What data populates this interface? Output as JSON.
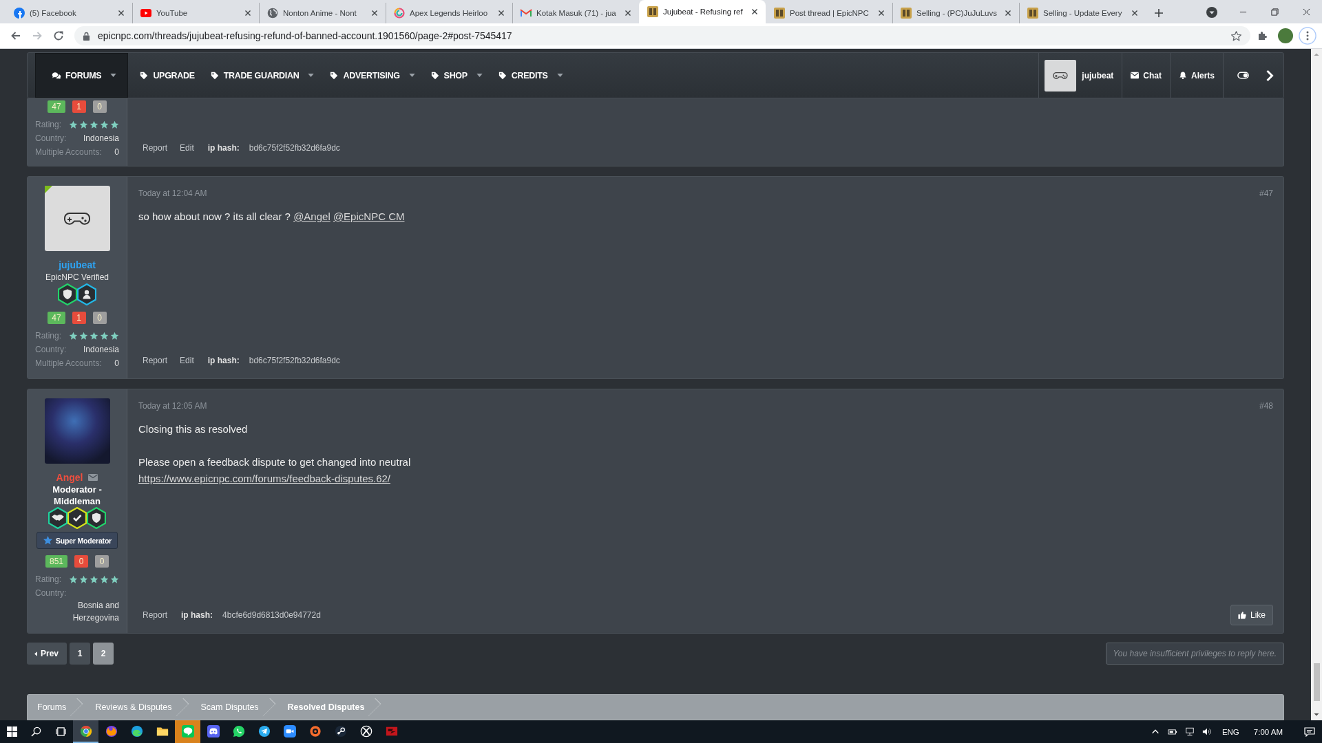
{
  "browser": {
    "tabs": [
      {
        "title": "(5) Facebook",
        "kind": "round",
        "selected": false
      },
      {
        "title": "YouTube",
        "kind": "video",
        "selected": false
      },
      {
        "title": "Nonton Anime - Nont",
        "kind": "globe",
        "selected": false
      },
      {
        "title": "Apex Legends Heirloo",
        "kind": "swirl",
        "selected": false
      },
      {
        "title": "Kotak Masuk (71) - jua",
        "kind": "mail",
        "selected": false
      },
      {
        "title": "Jujubeat - Refusing ref",
        "kind": "site",
        "selected": true
      },
      {
        "title": "Post thread | EpicNPC",
        "kind": "site",
        "selected": false
      },
      {
        "title": "Selling - (PC)JuJuLuvs",
        "kind": "site",
        "selected": false
      },
      {
        "title": "Selling - Update Every",
        "kind": "site",
        "selected": false
      }
    ],
    "toolbar": [
      {
        "kind": "back",
        "disabled": false
      },
      {
        "kind": "forward",
        "disabled": true
      },
      {
        "kind": "reload",
        "disabled": false
      }
    ],
    "address": "epicnpc.com/threads/jujubeat-refusing-refund-of-banned-account.1901560/page-2#post-7545417"
  },
  "nav": {
    "items": [
      {
        "label": "FORUMS",
        "kind": "comments",
        "dropdown": true,
        "selected": true
      },
      {
        "label": "UPGRADE",
        "kind": "tag",
        "dropdown": false,
        "selected": false
      },
      {
        "label": "TRADE GUARDIAN",
        "kind": "tag",
        "dropdown": true,
        "selected": false
      },
      {
        "label": "ADVERTISING",
        "kind": "tag",
        "dropdown": true,
        "selected": false
      },
      {
        "label": "SHOP",
        "kind": "tag",
        "dropdown": true,
        "selected": false
      },
      {
        "label": "CREDITS",
        "kind": "tag",
        "dropdown": true,
        "selected": false
      }
    ],
    "account": {
      "name": "jujubeat"
    },
    "links": [
      {
        "label": "Chat",
        "kind": "envelope"
      },
      {
        "label": "Alerts",
        "kind": "bell"
      }
    ]
  },
  "posts": [
    {
      "stats": [
        {
          "value": "47",
          "color": "#5cb85c"
        },
        {
          "value": "1",
          "color": "#e74c3c"
        },
        {
          "value": "0",
          "color": "#9e9e9e"
        }
      ],
      "rating_label": "Rating:",
      "stars": 5,
      "fields": [
        {
          "label": "Country:",
          "value": "Indonesia"
        },
        {
          "label": "Multiple Accounts:",
          "value": "0"
        }
      ],
      "actions": [
        "Report",
        "Edit"
      ],
      "ip_label": "ip hash:",
      "ip_hash": "bd6c75f2f52fb32d6fa9dc"
    },
    {
      "author": {
        "name": "jujubeat",
        "color": "#2ea3f2",
        "title": "EpicNPC Verified",
        "staff": false,
        "mail": false,
        "online": true,
        "avatar": {
          "kind": "gamepad"
        }
      },
      "badges": [
        {
          "kind": "shield",
          "color": "#22d36b"
        },
        {
          "kind": "person",
          "color": "#22b8e8"
        }
      ],
      "stats": [
        {
          "value": "47",
          "color": "#5cb85c"
        },
        {
          "value": "1",
          "color": "#e74c3c"
        },
        {
          "value": "0",
          "color": "#9e9e9e"
        }
      ],
      "rating_label": "Rating:",
      "stars": 5,
      "fields": [
        {
          "label": "Country:",
          "value": "Indonesia"
        },
        {
          "label": "Multiple Accounts:",
          "value": "0"
        }
      ],
      "time": "Today at 12:04 AM",
      "number": "#47",
      "body": [
        [
          [
            {
              "text": "so how about now ? its all clear ? ",
              "link": false
            },
            {
              "text": "@Angel",
              "link": true
            },
            {
              "text": "@EpicNPC CM",
              "link": true
            }
          ]
        ]
      ],
      "actions": [
        "Report",
        "Edit"
      ],
      "ip_label": "ip hash:",
      "ip_hash": "bd6c75f2f52fb32d6fa9dc"
    },
    {
      "author": {
        "name": "Angel",
        "color": "#f04e3e",
        "title": "Moderator - Middleman",
        "staff": true,
        "mail": true,
        "online": false,
        "avatar": {
          "kind": "image"
        }
      },
      "badges": [
        {
          "kind": "handshake",
          "color": "#1fd39e"
        },
        {
          "kind": "check",
          "color": "#d6e01a"
        },
        {
          "kind": "shield",
          "color": "#22d36b"
        }
      ],
      "banner": {
        "text": "Super Moderator"
      },
      "stats": [
        {
          "value": "851",
          "color": "#5cb85c"
        },
        {
          "value": "0",
          "color": "#e74c3c"
        },
        {
          "value": "0",
          "color": "#9e9e9e"
        }
      ],
      "rating_label": "Rating:",
      "stars": 5,
      "fields": [
        {
          "label": "Country:",
          "value": "Bosnia and Herzegovina"
        }
      ],
      "time": "Today at 12:05 AM",
      "number": "#48",
      "body": [
        [
          [
            {
              "text": "Closing this as resolved",
              "link": false
            }
          ]
        ],
        [
          [
            {
              "text": "Please open a feedback dispute to get changed into neutral",
              "link": false
            }
          ],
          [
            {
              "text": "https://www.epicnpc.com/forums/feedback-disputes.62/",
              "link": true
            }
          ]
        ]
      ],
      "actions": [
        "Report"
      ],
      "ip_label": "ip hash:",
      "ip_hash": "4bcfe6d9d6813d0e94772d",
      "like": {
        "label": "Like"
      }
    }
  ],
  "pagination": {
    "prev": "Prev",
    "pages": [
      {
        "label": "1",
        "selected": false
      },
      {
        "label": "2",
        "selected": true
      }
    ]
  },
  "reply_notice": "You have insufficient privileges to reply here.",
  "breadcrumb": [
    {
      "label": "Forums",
      "selected": false
    },
    {
      "label": "Reviews & Disputes",
      "selected": false
    },
    {
      "label": "Scam Disputes",
      "selected": false
    },
    {
      "label": "Resolved Disputes",
      "selected": true
    }
  ],
  "taskbar": {
    "apps": [
      {
        "kind": "browser",
        "selected": true,
        "flashing": false
      },
      {
        "kind": "fox",
        "selected": false,
        "flashing": false
      },
      {
        "kind": "wave",
        "selected": false,
        "flashing": false
      },
      {
        "kind": "folder",
        "selected": false,
        "flashing": false
      },
      {
        "kind": "chat",
        "selected": false,
        "flashing": true
      },
      {
        "kind": "game-chat",
        "selected": false,
        "flashing": false
      },
      {
        "kind": "phone",
        "selected": false,
        "flashing": false
      },
      {
        "kind": "plane",
        "selected": false,
        "flashing": false
      },
      {
        "kind": "camera",
        "selected": false,
        "flashing": false
      },
      {
        "kind": "ring",
        "selected": false,
        "flashing": false
      },
      {
        "kind": "valve",
        "selected": false,
        "flashing": false
      },
      {
        "kind": "x-ball",
        "selected": false,
        "flashing": false
      },
      {
        "kind": "flag",
        "selected": false,
        "flashing": false
      }
    ],
    "language": "ENG",
    "time": "7:00 AM"
  }
}
